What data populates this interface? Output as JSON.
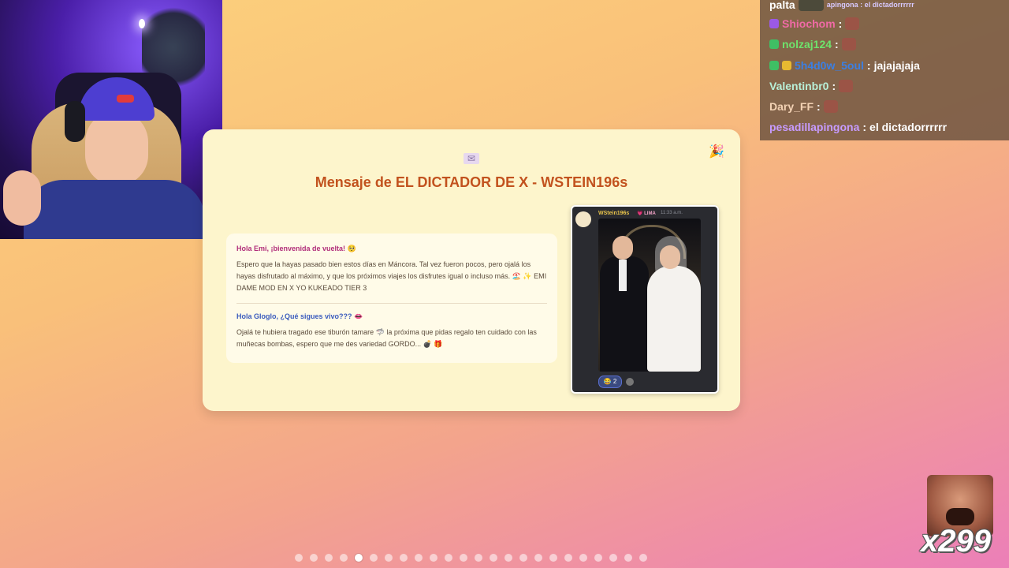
{
  "chat": {
    "lines": [
      {
        "user": "palta",
        "message": "apingona : el dictadorrrrrr"
      },
      {
        "user": "Shiochom",
        "sep": ":",
        "user_color": "#f06aa6"
      },
      {
        "user": "nolzaj124",
        "sep": ":",
        "user_color": "#6ee36c"
      },
      {
        "user": "5h4d0w_5oul",
        "sep": ":",
        "message": "jajajajaja",
        "user_color": "#3b7fe3"
      },
      {
        "user": "Valentinbr0",
        "sep": ":",
        "user_color": "#b8f0d8"
      },
      {
        "user": "Dary_FF",
        "sep": ":",
        "user_color": "#f3d2b4"
      },
      {
        "user": "pesadillapingona",
        "sep": ":",
        "message": "el dictadorrrrrr",
        "user_color": "#c79bff"
      }
    ]
  },
  "card": {
    "title_prefix": "Mensaje de EL DICTADOR DE X - ",
    "title_highlight": "WSTEIN196s",
    "message1": {
      "heading": "Hola Emi, ¡bienvenida de vuelta! 🥺",
      "body": "Espero que la hayas pasado bien estos días en Máncora. Tal vez fueron pocos, pero ojalá los hayas disfrutado al máximo, y que los próximos viajes los disfrutes igual o incluso más. 🏖️ ✨ EMI DAME MOD EN X YO KUKEADO TIER 3"
    },
    "message2": {
      "heading": "Hola Gloglo, ¿Qué sigues vivo??? 👄",
      "body": "Ojalá te hubiera tragado ese tiburón tamare 🦈 la próxima que pidas regalo ten cuidado con las muñecas bombas, espero que me des variedad GORDO... 💣 🎁"
    },
    "photo_post": {
      "author": "WStein196s",
      "tag": "💗 LIMA",
      "time": "11:33 a.m.",
      "reaction_count": "2"
    }
  },
  "pagination": {
    "total": 24,
    "active_index": 4
  },
  "emote_counter": "x299",
  "colors": {
    "title": "#c2521e",
    "highlight_bg": "#1d3e8a",
    "card_bg": "#fdf5cc"
  }
}
